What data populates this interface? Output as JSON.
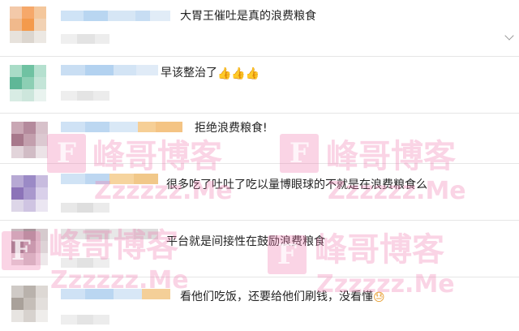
{
  "comments": [
    {
      "text": "大胃王催吐是真的浪费粮食",
      "emoji": ""
    },
    {
      "text": "早该整治了",
      "emoji": "👍👍👍"
    },
    {
      "text": "拒绝浪费粮食!",
      "emoji": ""
    },
    {
      "text": "很多吃了吐吐了吃以量博眼球的不就是在浪费粮食么",
      "emoji": ""
    },
    {
      "text": "平台就是间接性在鼓励浪费粮食",
      "emoji": ""
    },
    {
      "text": "看他们吃饭，还要给他们刷钱，没看懂",
      "emoji": "😓"
    }
  ],
  "watermark": {
    "logo_letter": "F",
    "brand": "峰哥博客",
    "domain": "Zzzzzz.Me"
  },
  "colors": {
    "watermark": "#ee78af",
    "text": "#222222",
    "divider": "#e6e6e6"
  }
}
